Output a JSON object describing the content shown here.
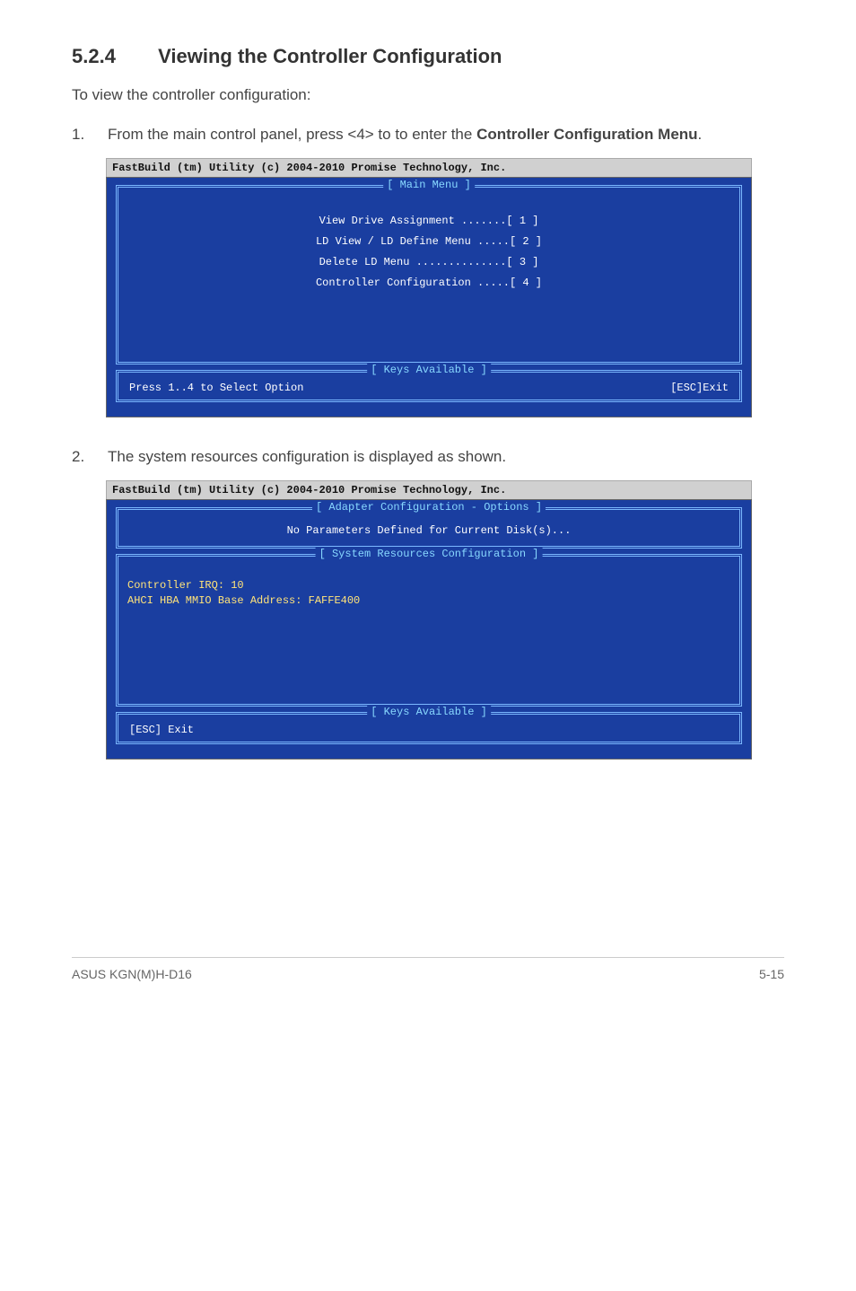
{
  "heading": {
    "number": "5.2.4",
    "title": "Viewing the Controller Configuration"
  },
  "intro": "To view the controller configuration:",
  "steps": [
    {
      "num": "1.",
      "pre": "From the main control panel, press <4> to to enter the ",
      "bold": "Controller Configuration Menu",
      "post": "."
    },
    {
      "num": "2.",
      "pre": "The system resources configuration is displayed as shown.",
      "bold": "",
      "post": ""
    }
  ],
  "console1": {
    "header": "FastBuild (tm) Utility (c) 2004-2010 Promise Technology, Inc.",
    "mainMenuTitle": "[ Main Menu ]",
    "items": [
      "View Drive Assignment .......[ 1 ]",
      "LD View / LD Define Menu .....[ 2 ]",
      "Delete LD Menu ..............[ 3 ]",
      "Controller Configuration .....[ 4 ]"
    ],
    "keysTitle": "[ Keys Available ]",
    "keysLeft": "Press 1..4 to Select Option",
    "keysRight": "[ESC]Exit"
  },
  "console2": {
    "header": "FastBuild (tm) Utility (c) 2004-2010 Promise Technology, Inc.",
    "adapterTitle": "[ Adapter Configuration - Options ]",
    "adapterMsg": "No Parameters Defined for Current Disk(s)...",
    "sysTitle": "[ System Resources Configuration ]",
    "sysLine1": "Controller IRQ: 10",
    "sysLine2": "AHCI HBA MMIO Base Address: FAFFE400",
    "keysTitle": "[ Keys Available ]",
    "keysLeft": "[ESC] Exit"
  },
  "footer": {
    "left": "ASUS KGN(M)H-D16",
    "right": "5-15"
  }
}
